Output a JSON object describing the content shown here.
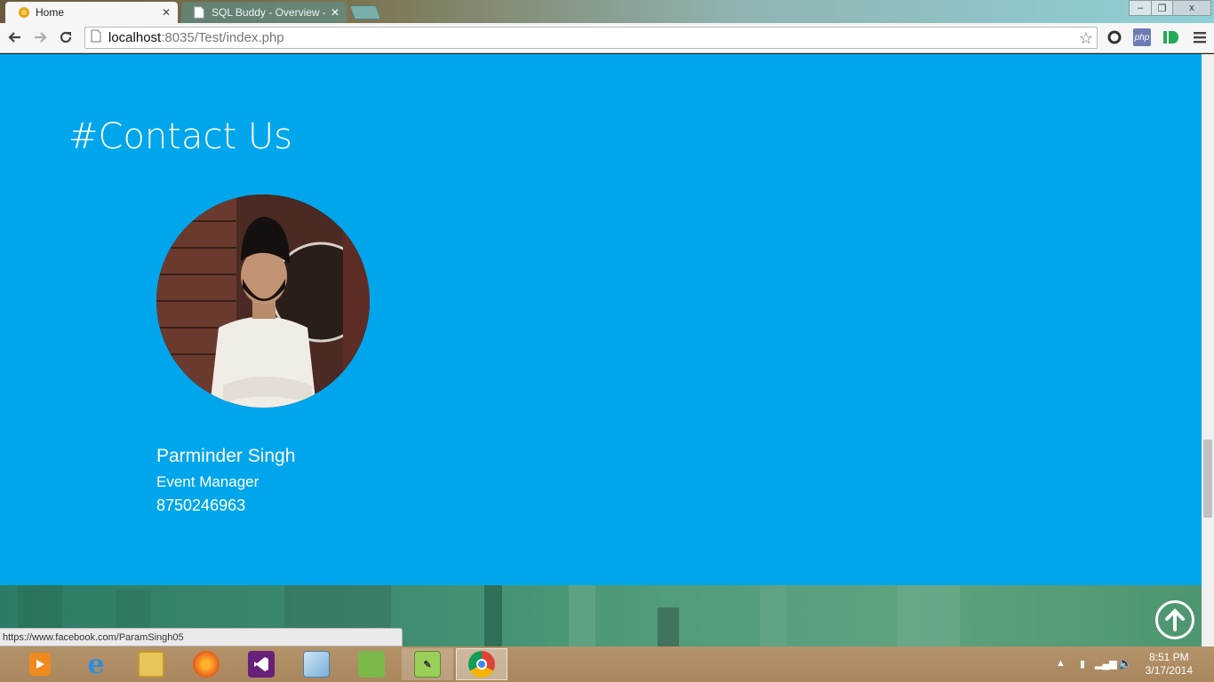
{
  "browser": {
    "tabs": [
      {
        "title": "Home",
        "active": true
      },
      {
        "title": "SQL Buddy - Overview - s",
        "active": false
      }
    ],
    "url_host": "localhost",
    "url_rest": ":8035/Test/index.php",
    "status_url": "https://www.facebook.com/ParamSingh05",
    "window_controls": {
      "minimize": "–",
      "restore": "❐",
      "close": "x"
    },
    "extensions": [
      "php"
    ]
  },
  "page": {
    "heading": "#Contact Us",
    "contact": {
      "name": "Parminder Singh",
      "role": "Event Manager",
      "phone": "8750246963"
    },
    "colors": {
      "background": "#00a6ec"
    }
  },
  "taskbar": {
    "apps": [
      {
        "name": "windows-media-player-icon"
      },
      {
        "name": "internet-explorer-icon"
      },
      {
        "name": "file-explorer-icon"
      },
      {
        "name": "firefox-icon"
      },
      {
        "name": "visual-studio-icon"
      },
      {
        "name": "virtualbox-icon"
      },
      {
        "name": "evernote-icon"
      },
      {
        "name": "notepad-plus-plus-icon"
      },
      {
        "name": "chrome-icon",
        "active": true
      }
    ],
    "time": "8:51 PM",
    "date": "3/17/2014"
  }
}
